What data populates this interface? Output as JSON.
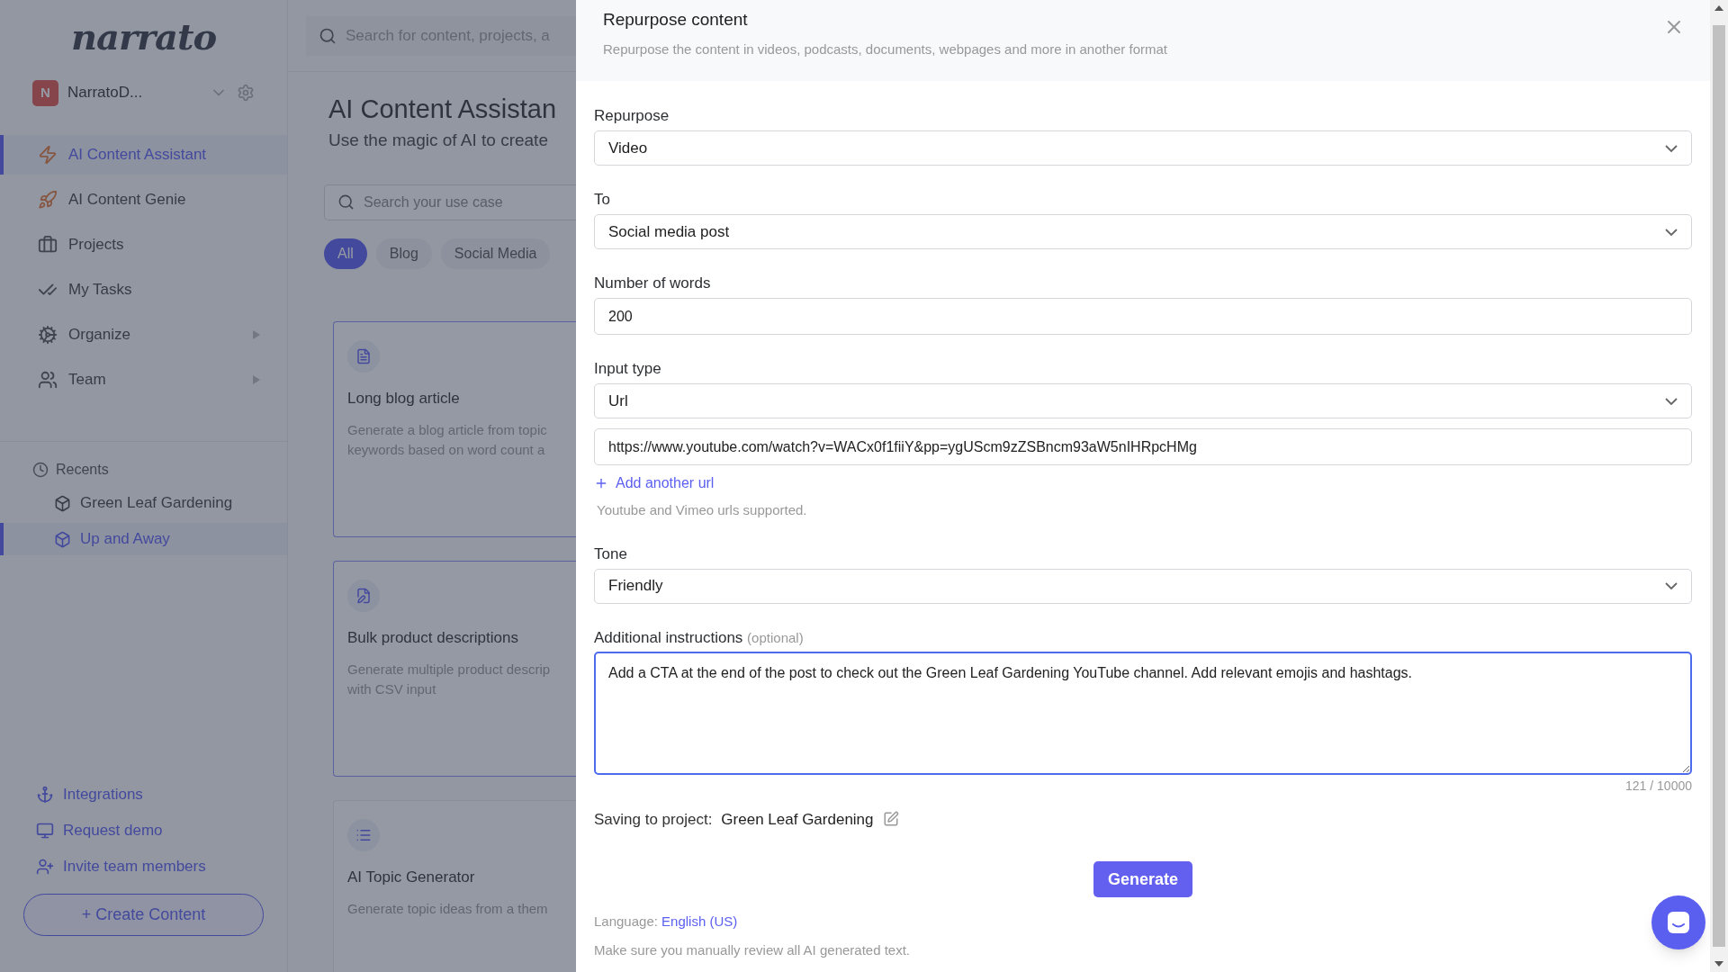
{
  "sidebar": {
    "logo": "narrato",
    "workspace": {
      "initial": "N",
      "name": "NarratoD..."
    },
    "nav": [
      {
        "label": "AI Content Assistant",
        "selected": true,
        "expandable": false
      },
      {
        "label": "AI Content Genie",
        "selected": false,
        "expandable": false
      },
      {
        "label": "Projects",
        "selected": false,
        "expandable": false
      },
      {
        "label": "My Tasks",
        "selected": false,
        "expandable": false
      },
      {
        "label": "Organize",
        "selected": false,
        "expandable": true
      },
      {
        "label": "Team",
        "selected": false,
        "expandable": true
      }
    ],
    "recents": {
      "title": "Recents",
      "items": [
        {
          "label": "Green Leaf Gardening",
          "selected": false
        },
        {
          "label": "Up and Away",
          "selected": true
        }
      ]
    },
    "links": [
      "Integrations",
      "Request demo",
      "Invite team members"
    ],
    "create_button": "+ Create Content"
  },
  "main": {
    "search_placeholder": "Search for content, projects, a",
    "title": "AI Content Assistan",
    "subtitle": "Use the magic of AI to create",
    "usecase_placeholder": "Search your use case",
    "filters": [
      {
        "label": "All",
        "selected": true
      },
      {
        "label": "Blog",
        "selected": false
      },
      {
        "label": "Social Media",
        "selected": false
      }
    ],
    "cards": [
      {
        "title": "Long blog article",
        "description": "Generate a blog article from topic keywords based on word count a"
      },
      {
        "title": "Bulk product descriptions",
        "description": "Generate multiple product descrip with CSV input"
      },
      {
        "title": "AI Topic Generator",
        "description": "Generate topic ideas from a them"
      }
    ]
  },
  "modal": {
    "title": "Repurpose content",
    "subtitle": "Repurpose the content in videos, podcasts, documents, webpages and more in another format",
    "repurpose": {
      "label": "Repurpose",
      "value": "Video"
    },
    "to": {
      "label": "To",
      "value": "Social media post"
    },
    "words": {
      "label": "Number of words",
      "value": "200"
    },
    "input_type": {
      "label": "Input type",
      "value": "Url"
    },
    "urls": [
      "https://www.youtube.com/watch?v=WACx0f1fiiY&pp=ygUScm9zZSBncm93aW5nIHRpcHMg"
    ],
    "add_url": "Add another url",
    "url_hint": "Youtube and Vimeo urls supported.",
    "tone": {
      "label": "Tone",
      "value": "Friendly"
    },
    "instructions": {
      "label": "Additional instructions",
      "optional": "(optional)",
      "value": "Add a CTA at the end of the post to check out the Green Leaf Gardening YouTube channel. Add relevant emojis and hashtags.",
      "counter": "121 / 10000"
    },
    "saving": {
      "label": "Saving to project:",
      "project": "Green Leaf Gardening"
    },
    "generate": "Generate",
    "language": {
      "label": "Language:",
      "value": "English (US)"
    },
    "disclaimer": "Make sure you manually review all AI generated text."
  }
}
